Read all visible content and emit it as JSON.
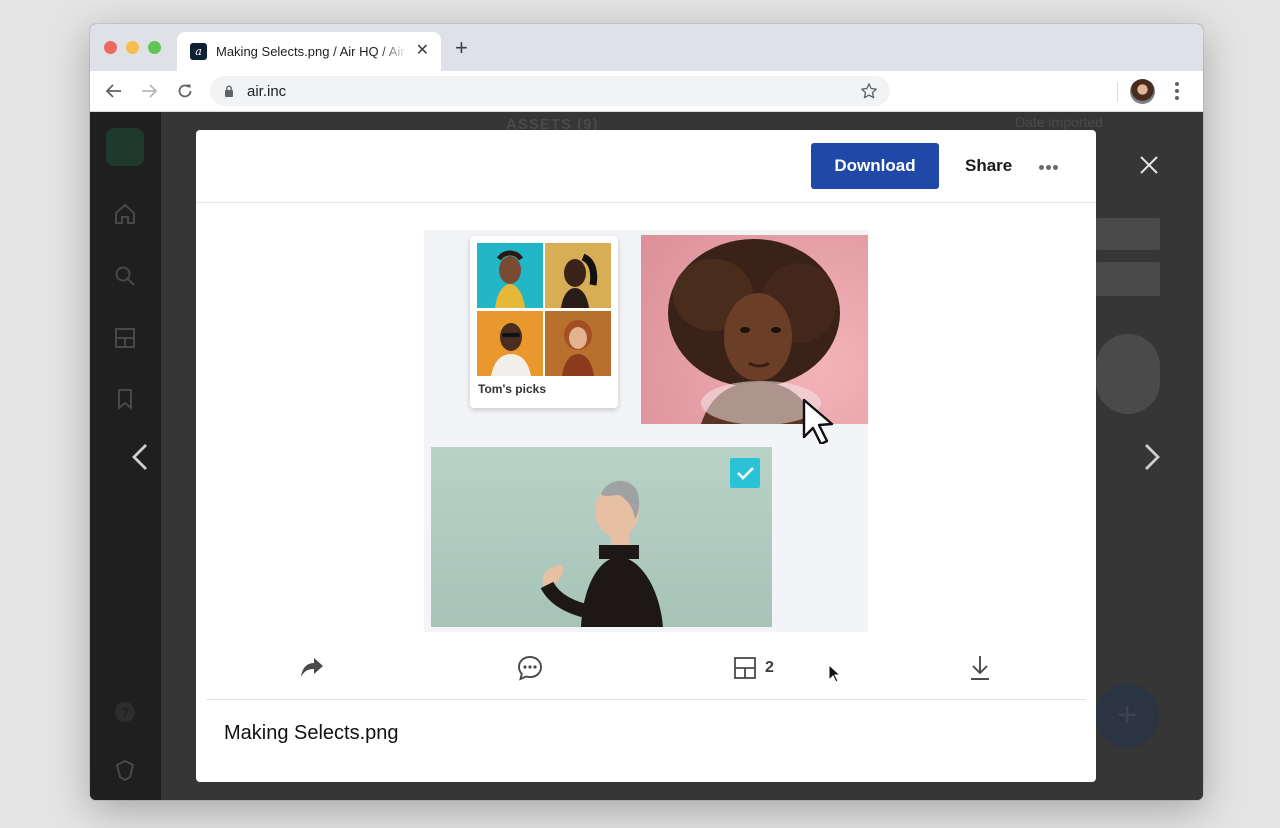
{
  "browser": {
    "tab_title": "Making Selects.png / Air HQ / Air",
    "tab_favicon_letter": "a",
    "url": "air.inc"
  },
  "background": {
    "assets_heading": "ASSETS (9)",
    "sort_label": "Date imported"
  },
  "modal": {
    "download_label": "Download",
    "share_label": "Share",
    "filename": "Making Selects.png",
    "board_card_label": "Tom's picks",
    "versions_count": "2"
  },
  "colors": {
    "download_bg": "#1f48a8",
    "checkbox": "#2ac3d6"
  },
  "icons": {
    "share": "share-arrow-icon",
    "comment": "comment-icon",
    "versions": "versions-icon",
    "download": "download-icon"
  }
}
